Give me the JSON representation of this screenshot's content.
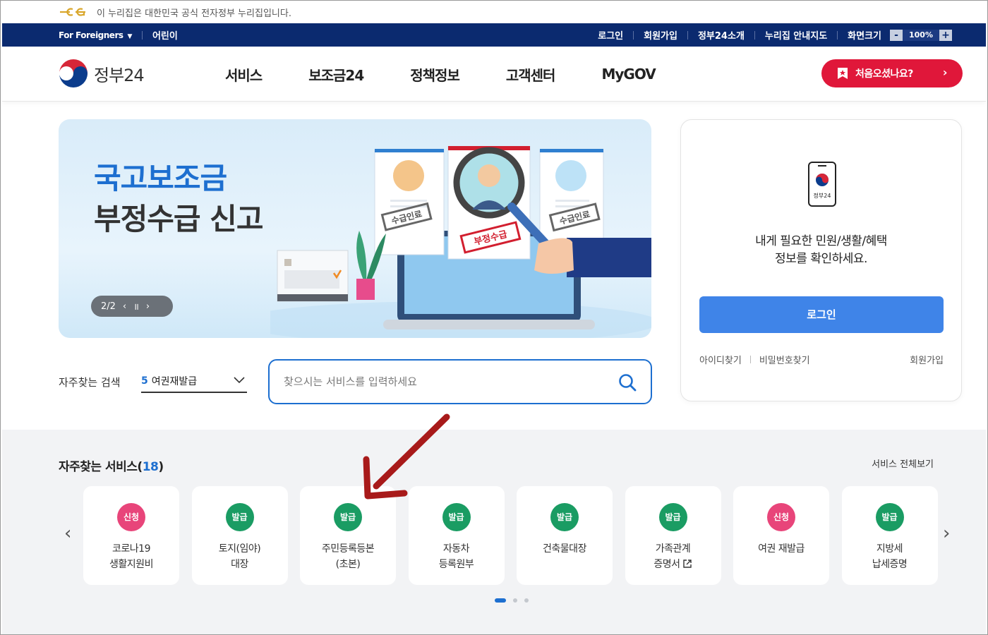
{
  "gov_banner": {
    "text": "이 누리집은 대한민국 공식 전자정부 누리집입니다."
  },
  "util_bar": {
    "language": "For Foreigners",
    "kids": "어린이",
    "links": [
      "로그인",
      "회원가입",
      "정부24소개",
      "누리집 안내지도"
    ],
    "screen_size_label": "화면크기",
    "zoom_minus": "-",
    "zoom_value": "100%",
    "zoom_plus": "+"
  },
  "header": {
    "logo_text": "정부24",
    "menu": [
      "서비스",
      "보조금24",
      "정책정보",
      "고객센터",
      "MyGOV"
    ],
    "first_visit_button": "처음오셨나요?",
    "first_visit_arrow": "›"
  },
  "hero": {
    "title_line1": "국고보조금",
    "title_line2": "부정수급 신고",
    "stamp_left": "수급인료",
    "stamp_center": "부정수급",
    "stamp_right": "수급인료",
    "pager": {
      "current": "2/2",
      "prev": "‹",
      "pause": "॥",
      "next": "›"
    }
  },
  "search": {
    "frequent_label": "자주찾는 검색",
    "frequent_rank": "5",
    "frequent_term": "여권재발급",
    "placeholder": "찾으시는 서비스를 입력하세요"
  },
  "login_panel": {
    "icon_text": "정부24",
    "message_line1": "내게 필요한 민원/생활/혜택",
    "message_line2": "정보를 확인하세요.",
    "login_button": "로그인",
    "find_id": "아이디찾기",
    "find_password": "비밀번호찾기",
    "join": "회원가입"
  },
  "services": {
    "title": "자주찾는 서비스",
    "count_open": "(",
    "count": "18",
    "count_close": ")",
    "view_all": "서비스 전체보기",
    "prev": "‹",
    "next": "›",
    "items": [
      {
        "badge": "신청",
        "badge_color": "#e8457a",
        "line1": "코로나19",
        "line2": "생활지원비"
      },
      {
        "badge": "발급",
        "badge_color": "#1a9c63",
        "line1": "토지(임야)",
        "line2": "대장"
      },
      {
        "badge": "발급",
        "badge_color": "#1a9c63",
        "line1": "주민등록등본",
        "line2": "(초본)"
      },
      {
        "badge": "발급",
        "badge_color": "#1a9c63",
        "line1": "자동차",
        "line2": "등록원부"
      },
      {
        "badge": "발급",
        "badge_color": "#1a9c63",
        "line1": "건축물대장",
        "line2": ""
      },
      {
        "badge": "발급",
        "badge_color": "#1a9c63",
        "line1": "가족관계",
        "line2": "증명서"
      },
      {
        "badge": "신청",
        "badge_color": "#e8457a",
        "line1": "여권 재발급",
        "line2": ""
      },
      {
        "badge": "발급",
        "badge_color": "#1a9c63",
        "line1": "지방세",
        "line2": "납세증명"
      }
    ],
    "pages": 3,
    "active_page": 1
  },
  "colors": {
    "navy": "#0b2a6f",
    "brand_blue": "#1d6fd0",
    "red": "#e0173a",
    "green_badge": "#1a9c63",
    "pink_badge": "#e8457a",
    "annotation_arrow": "#a81a1a"
  }
}
